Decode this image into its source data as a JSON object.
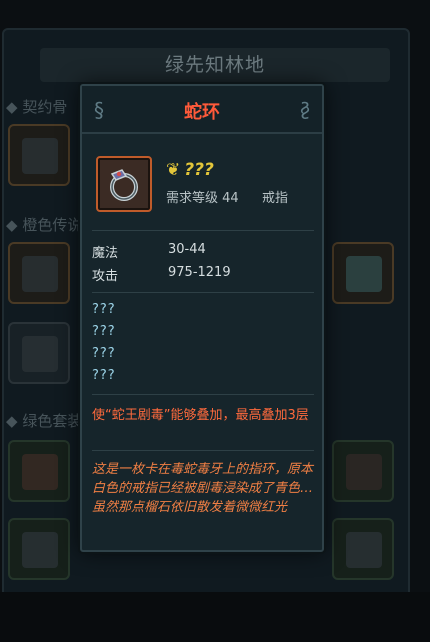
{
  "background": {
    "area_title": "绿先知林地",
    "sections": [
      "契约骨",
      "橙色传说",
      "绿色套装"
    ]
  },
  "popup": {
    "title": "蛇环",
    "quality_text": "???",
    "required_level": "需求等级 44",
    "item_type": "戒指",
    "stats": [
      {
        "label": "魔法",
        "value": "30-44"
      },
      {
        "label": "攻击",
        "value": "975-1219"
      }
    ],
    "unknown_affixes": [
      "???",
      "???",
      "???",
      "???"
    ],
    "effect": "使“蛇王剧毒”能够叠加，最高叠加3层",
    "lore": "这是一枚卡在毒蛇毒牙上的指环，原本白色的戒指已经被剧毒浸染成了青色…虽然那点榴石依旧散发着微微红光"
  },
  "colors": {
    "title": "#ff5a3a",
    "quality": "#e3c63a",
    "unknown": "#9cd4e8",
    "effect": "#ff6a3d",
    "item_border": "#c05b2a"
  },
  "icons": {
    "item": "ring-icon",
    "quality": "leaf-quality-icon",
    "header_left": "flourish-icon",
    "header_right": "flourish-icon"
  }
}
